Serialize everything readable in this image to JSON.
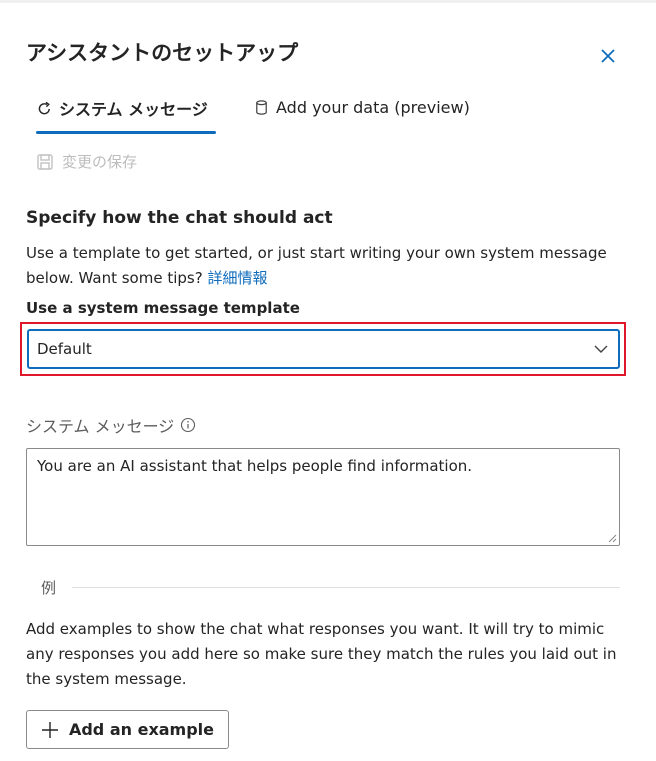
{
  "panel": {
    "title": "アシスタントのセットアップ"
  },
  "tabs": [
    {
      "label": "システム メッセージ",
      "icon": "refresh-icon",
      "selected": true
    },
    {
      "label": "Add your data (preview)",
      "icon": "database-icon",
      "selected": false
    }
  ],
  "toolbar": {
    "save_label": "変更の保存",
    "save_icon": "save-icon"
  },
  "section": {
    "heading": "Specify how the chat should act",
    "description": "Use a template to get started, or just start writing your own system message below. Want some tips? ",
    "learn_more_link": "詳細情報"
  },
  "template": {
    "label": "Use a system message template",
    "selected_value": "Default"
  },
  "system_message": {
    "label": "システム メッセージ",
    "value": "You are an AI assistant that helps people find information."
  },
  "examples": {
    "label": "例",
    "description": "Add examples to show the chat what responses you want. It will try to mimic any responses you add here so make sure they match the rules you laid out in the system message.",
    "add_button_label": "Add an example"
  },
  "colors": {
    "accent": "#0f6cbd",
    "highlight": "#e0162b"
  }
}
